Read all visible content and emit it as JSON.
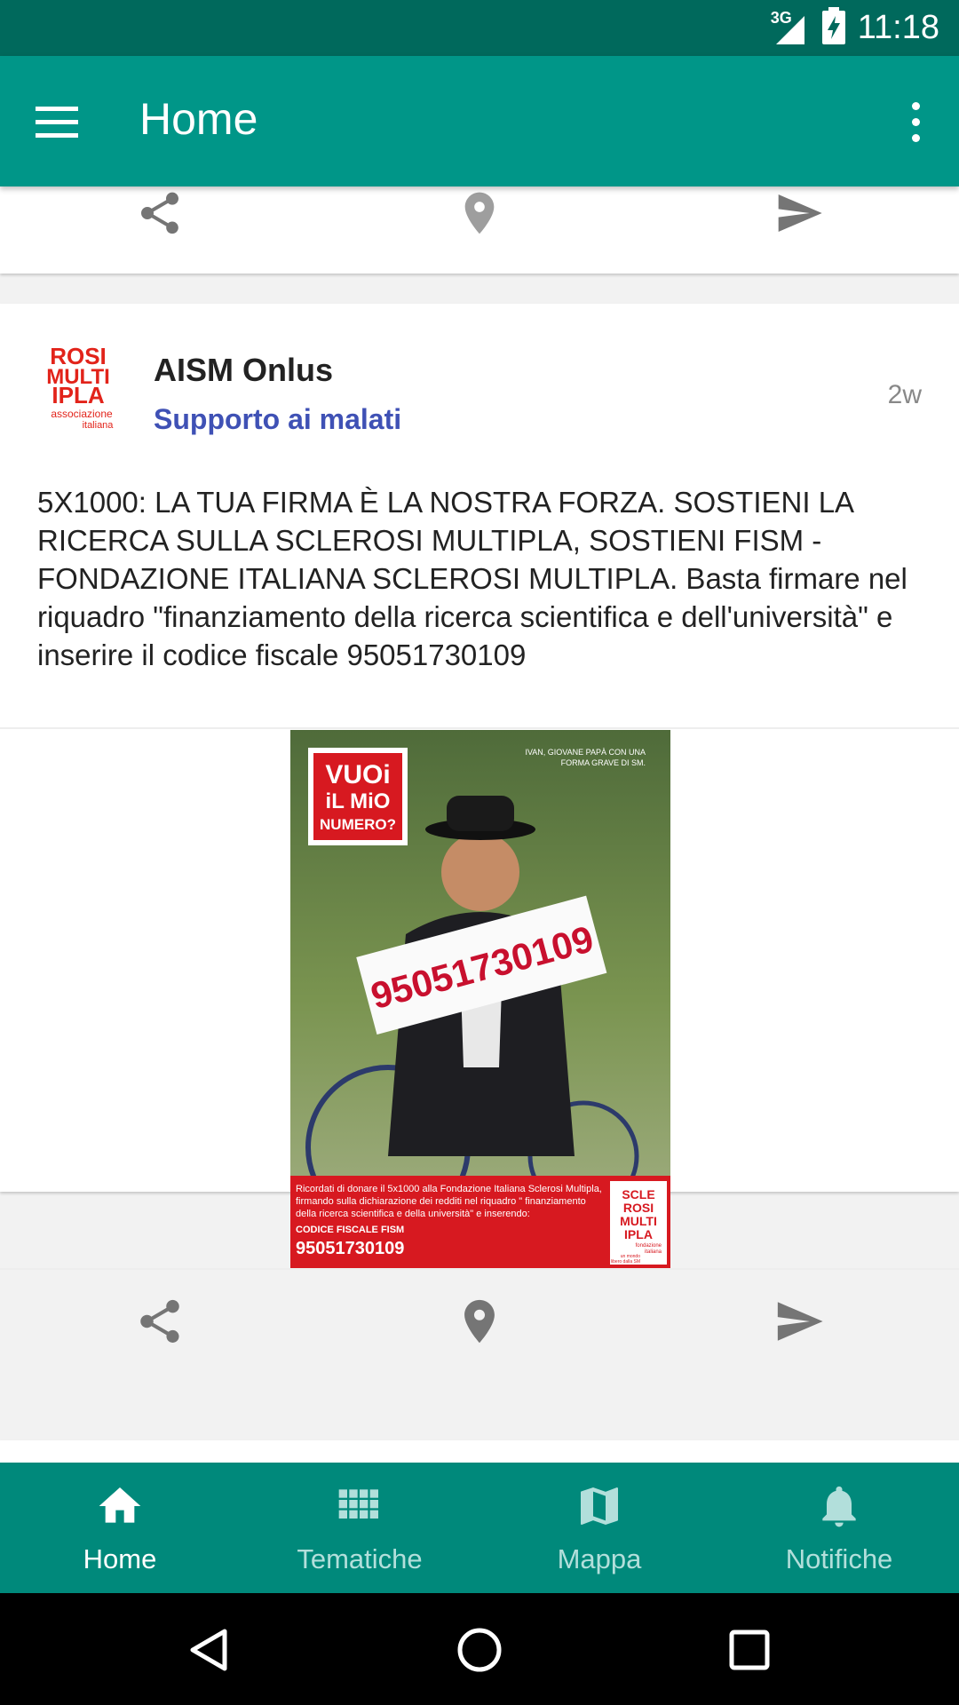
{
  "status_bar": {
    "network": "3G",
    "time": "11:18"
  },
  "app_bar": {
    "title": "Home"
  },
  "post": {
    "author": "AISM Onlus",
    "category": "Supporto ai malati",
    "age": "2w",
    "text": "5X1000: LA TUA FIRMA È LA NOSTRA FORZA. SOSTIENI LA RICERCA SULLA SCLEROSI MULTIPLA, SOSTIENI FISM - FONDAZIONE ITALIANA SCLEROSI MULTIPLA. Basta firmare nel riquadro \"finanziamento della ricerca scientifica e dell'università\" e inserire il codice fiscale 95051730109",
    "avatar": {
      "line1": "ROSI",
      "line2": "MULTI",
      "line3": "IPLA",
      "line4": "associazione",
      "line5": "italiana"
    },
    "poster": {
      "headline1": "VUOi",
      "headline2": "iL MiO",
      "headline3": "NUMERO?",
      "caption1": "IVAN, GIOVANE PAPÀ CON UNA",
      "caption2": "FORMA GRAVE DI SM.",
      "sign_number": "95051730109",
      "footer1": "Ricordati di donare il 5x1000 alla Fondazione Italiana Sclerosi Multipla,",
      "footer2": "firmando sulla dichiarazione dei redditi nel riquadro \" finanziamento",
      "footer3": "della ricerca scientifica e della università\" e inserendo:",
      "footer_label": "CODICE FISCALE FISM",
      "footer_code": "95051730109",
      "logo1": "SCLE",
      "logo2": "ROSI",
      "logo3": "MULTI",
      "logo4": "IPLA",
      "logo5": "fondazione",
      "logo6": "italiana",
      "logo7": "un mondo",
      "logo8": "libero dalla SM"
    }
  },
  "bottom_nav": [
    {
      "label": "Home",
      "icon": "home-icon",
      "active": true
    },
    {
      "label": "Tematiche",
      "icon": "grid-icon",
      "active": false
    },
    {
      "label": "Mappa",
      "icon": "map-icon",
      "active": false
    },
    {
      "label": "Notifiche",
      "icon": "bell-icon",
      "active": false
    }
  ],
  "colors": {
    "primary": "#009688",
    "primary_dark": "#00695c",
    "accent_text": "#3f51b5",
    "icon_gray": "#757575"
  }
}
